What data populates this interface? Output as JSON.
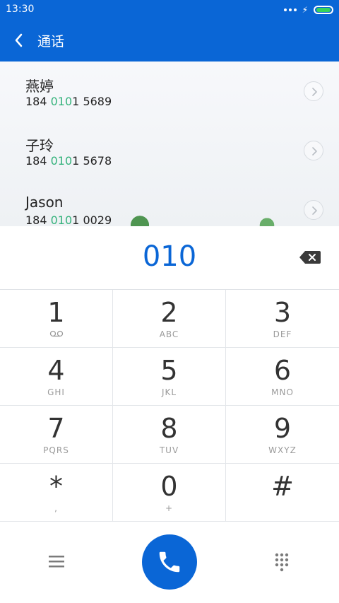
{
  "status_bar": {
    "time": "13:30"
  },
  "header": {
    "title": "通话"
  },
  "contacts": [
    {
      "name": "燕婷",
      "number_prefix": "184 ",
      "number_match": "010",
      "number_suffix": "1 5689"
    },
    {
      "name": "子玲",
      "number_prefix": "184 ",
      "number_match": "010",
      "number_suffix": "1 5678"
    },
    {
      "name": "Jason",
      "number_prefix": "184 ",
      "number_match": "010",
      "number_suffix": "1 0029"
    }
  ],
  "dial": {
    "digits": "010"
  },
  "keypad": [
    {
      "digit": "1",
      "letters": ""
    },
    {
      "digit": "2",
      "letters": "ABC"
    },
    {
      "digit": "3",
      "letters": "DEF"
    },
    {
      "digit": "4",
      "letters": "GHI"
    },
    {
      "digit": "5",
      "letters": "JKL"
    },
    {
      "digit": "6",
      "letters": "MNO"
    },
    {
      "digit": "7",
      "letters": "PQRS"
    },
    {
      "digit": "8",
      "letters": "TUV"
    },
    {
      "digit": "9",
      "letters": "WXYZ"
    },
    {
      "digit": "*",
      "letters": ","
    },
    {
      "digit": "0",
      "letters": "+"
    },
    {
      "digit": "#",
      "letters": ""
    }
  ],
  "icons": {
    "back": "back-arrow-icon",
    "chevron": "chevron-right-icon",
    "backspace": "backspace-icon",
    "voicemail": "voicemail-icon",
    "menu": "menu-icon",
    "call": "phone-icon",
    "keypad": "keypad-icon"
  },
  "colors": {
    "primary": "#0a66d6",
    "match_highlight": "#34b27b",
    "battery": "#36d45a"
  },
  "battery_level": 1.0
}
